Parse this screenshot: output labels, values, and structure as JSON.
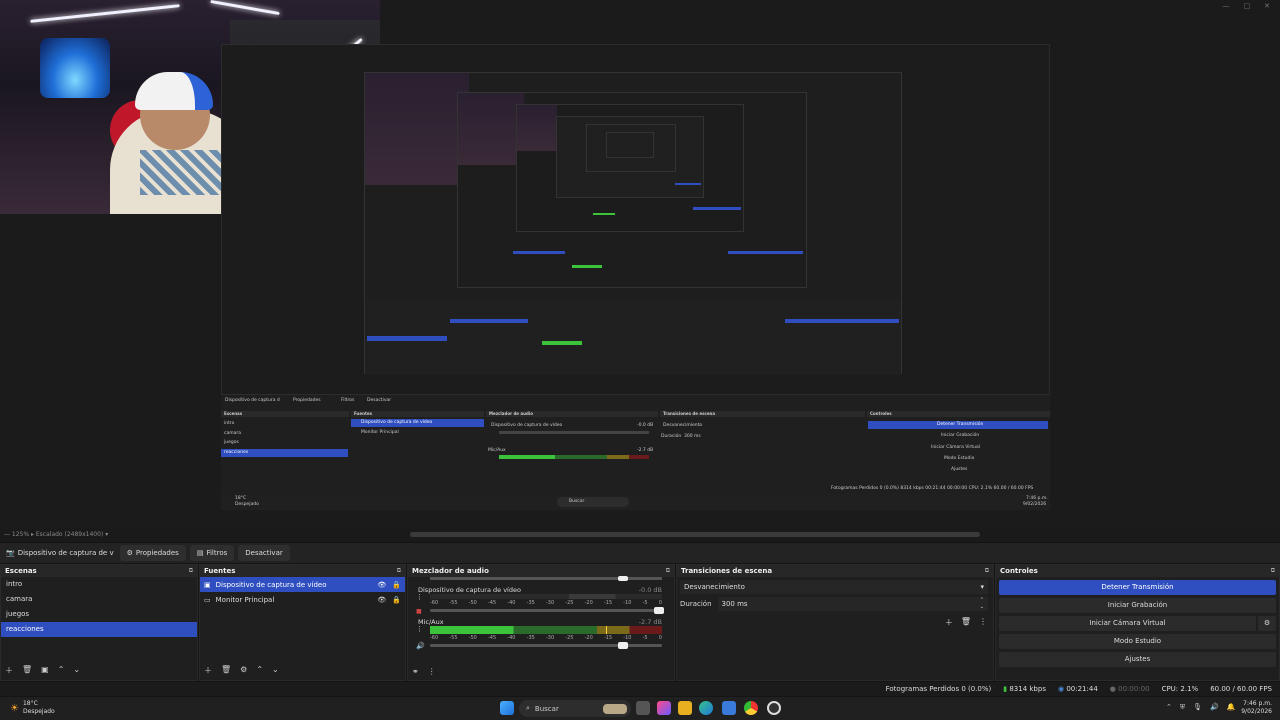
{
  "preview": {
    "window_controls": [
      "—",
      "□",
      "✕"
    ]
  },
  "mini": {
    "source_name": "Dispositivo de captura d",
    "props": "Propiedades",
    "filters": "Filtros",
    "deactivate": "Desactivar",
    "zoom": "— 125%  ▸  Escalado (2488x1400)  ▾",
    "scenes_title": "Escenas",
    "scenes": [
      "intro",
      "camara",
      "juegos",
      "reacciones"
    ],
    "sources_title": "Fuentes",
    "sources": [
      "Dispositivo de captura de vídeo",
      "Monitor Principal"
    ],
    "mixer_title": "Mezclador de audio",
    "mixer_ch1": "Dispositivo de captura de vídeo",
    "mixer_ch1_db": "-0.0 dB",
    "mixer_ch2": "Mic/Aux",
    "mixer_ch2_db": "-2.7 dB",
    "trans_title": "Transiciones de escena",
    "trans_value": "Desvanecimiento",
    "duration_label": "Duración",
    "duration_value": "300 ms",
    "controls_title": "Controles",
    "controls": [
      "Detener Transmisión",
      "Iniciar Grabación",
      "Iniciar Cámara Virtual",
      "Modo Estudio",
      "Ajustes"
    ],
    "status": "Fotogramas Perdidos 0 (0.0%)   8314 kbps   00:21:44   00:00:00   CPU: 2.1%   60.00 / 60.00 FPS",
    "weather_temp": "18°C",
    "weather_desc": "Despejado",
    "search": "Buscar",
    "clock": "7:46 p.m.",
    "date": "9/02/2026"
  },
  "zoombar": {
    "text": "—  125%  ▸  Escalado (2489x1400)  ▾"
  },
  "sourcebar": {
    "source_name": "Dispositivo de captura de v",
    "properties": "Propiedades",
    "filters": "Filtros",
    "deactivate": "Desactivar"
  },
  "scenes": {
    "title": "Escenas",
    "items": [
      "intro",
      "camara",
      "juegos",
      "reacciones"
    ],
    "selected_index": 3
  },
  "sources": {
    "title": "Fuentes",
    "items": [
      {
        "label": "Dispositivo de captura de vídeo",
        "icon": "camera-icon",
        "selected": true
      },
      {
        "label": "Monitor Principal",
        "icon": "monitor-icon",
        "selected": false
      }
    ]
  },
  "mixer": {
    "title": "Mezclador de audio",
    "channels": [
      {
        "name": "Dispositivo de captura de vídeo",
        "db": "-0.0 dB",
        "level": 0.0
      },
      {
        "name": "Mic/Aux",
        "db": "-2.7 dB",
        "level": 0.85
      }
    ],
    "ticks": [
      "-60",
      "-55",
      "-50",
      "-45",
      "-40",
      "-35",
      "-30",
      "-25",
      "-20",
      "-15",
      "-10",
      "-5",
      "0"
    ]
  },
  "transitions": {
    "title": "Transiciones de escena",
    "type": "Desvanecimiento",
    "duration_label": "Duración",
    "duration_value": "300 ms"
  },
  "controls": {
    "title": "Controles",
    "buttons": [
      "Detener Transmisión",
      "Iniciar Grabación",
      "Iniciar Cámara Virtual",
      "Modo Estudio",
      "Ajustes"
    ]
  },
  "status": {
    "dropped": "Fotogramas Perdidos 0 (0.0%)",
    "bitrate": "8314 kbps",
    "stream_time": "00:21:44",
    "rec_time": "00:00:00",
    "cpu": "CPU: 2.1%",
    "fps": "60.00 / 60.00 FPS"
  },
  "taskbar": {
    "temp": "18°C",
    "weather": "Despejado",
    "search": "Buscar",
    "time": "7:46 p.m.",
    "date": "9/02/2026"
  },
  "colors": {
    "accent": "#2f4fc0",
    "meter_green": "#3bc43b",
    "meter_yellow": "#c8a626",
    "meter_red": "#c8262a"
  }
}
